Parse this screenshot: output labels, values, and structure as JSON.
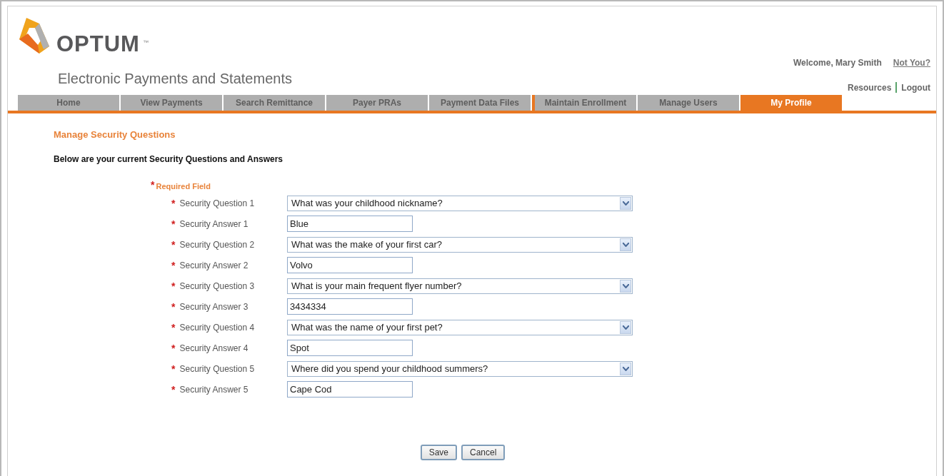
{
  "header": {
    "logo_text": "OPTUM",
    "trademark": "™",
    "subtitle": "Electronic Payments and Statements",
    "welcome": "Welcome, Mary Smith",
    "not_you_link": "Not You?",
    "links": [
      "Resources",
      "Logout"
    ]
  },
  "tabs": [
    {
      "label": "Home",
      "selected": false
    },
    {
      "label": "View Payments",
      "selected": false
    },
    {
      "label": "Search Remittance",
      "selected": false
    },
    {
      "label": "Payer PRAs",
      "selected": false
    },
    {
      "label": "Payment Data Files",
      "selected": false
    },
    {
      "label": "Maintain Enrollment",
      "selected": false
    },
    {
      "label": "Manage Users",
      "selected": false
    },
    {
      "label": "My Profile",
      "selected": true
    }
  ],
  "page": {
    "heading": "Manage Security Questions",
    "intro": "Below are your current Security Questions and Answers",
    "required_legend": {
      "mark": "*",
      "label": "Required Field"
    }
  },
  "fields": [
    {
      "kind": "question",
      "mark": "*",
      "label": "Security Question 1",
      "value": "What was your childhood nickname?"
    },
    {
      "kind": "answer",
      "mark": "*",
      "label": "Security Answer 1",
      "value": "Blue"
    },
    {
      "kind": "question",
      "mark": "*",
      "label": "Security Question 2",
      "value": "What was the make of your first car?"
    },
    {
      "kind": "answer",
      "mark": "*",
      "label": "Security Answer 2",
      "value": "Volvo"
    },
    {
      "kind": "question",
      "mark": "*",
      "label": "Security Question 3",
      "value": "What is your main frequent flyer number?"
    },
    {
      "kind": "answer",
      "mark": "*",
      "label": "Security Answer 3",
      "value": "3434334"
    },
    {
      "kind": "question",
      "mark": "*",
      "label": "Security Question 4",
      "value": "What was the name of your first pet?"
    },
    {
      "kind": "answer",
      "mark": "*",
      "label": "Security Answer 4",
      "value": "Spot"
    },
    {
      "kind": "question",
      "mark": "*",
      "label": "Security Question 5",
      "value": "Where did you spend your childhood summers?"
    },
    {
      "kind": "answer",
      "mark": "*",
      "label": "Security Answer 5",
      "value": "Cape Cod"
    }
  ],
  "buttons": [
    "Save",
    "Cancel"
  ]
}
